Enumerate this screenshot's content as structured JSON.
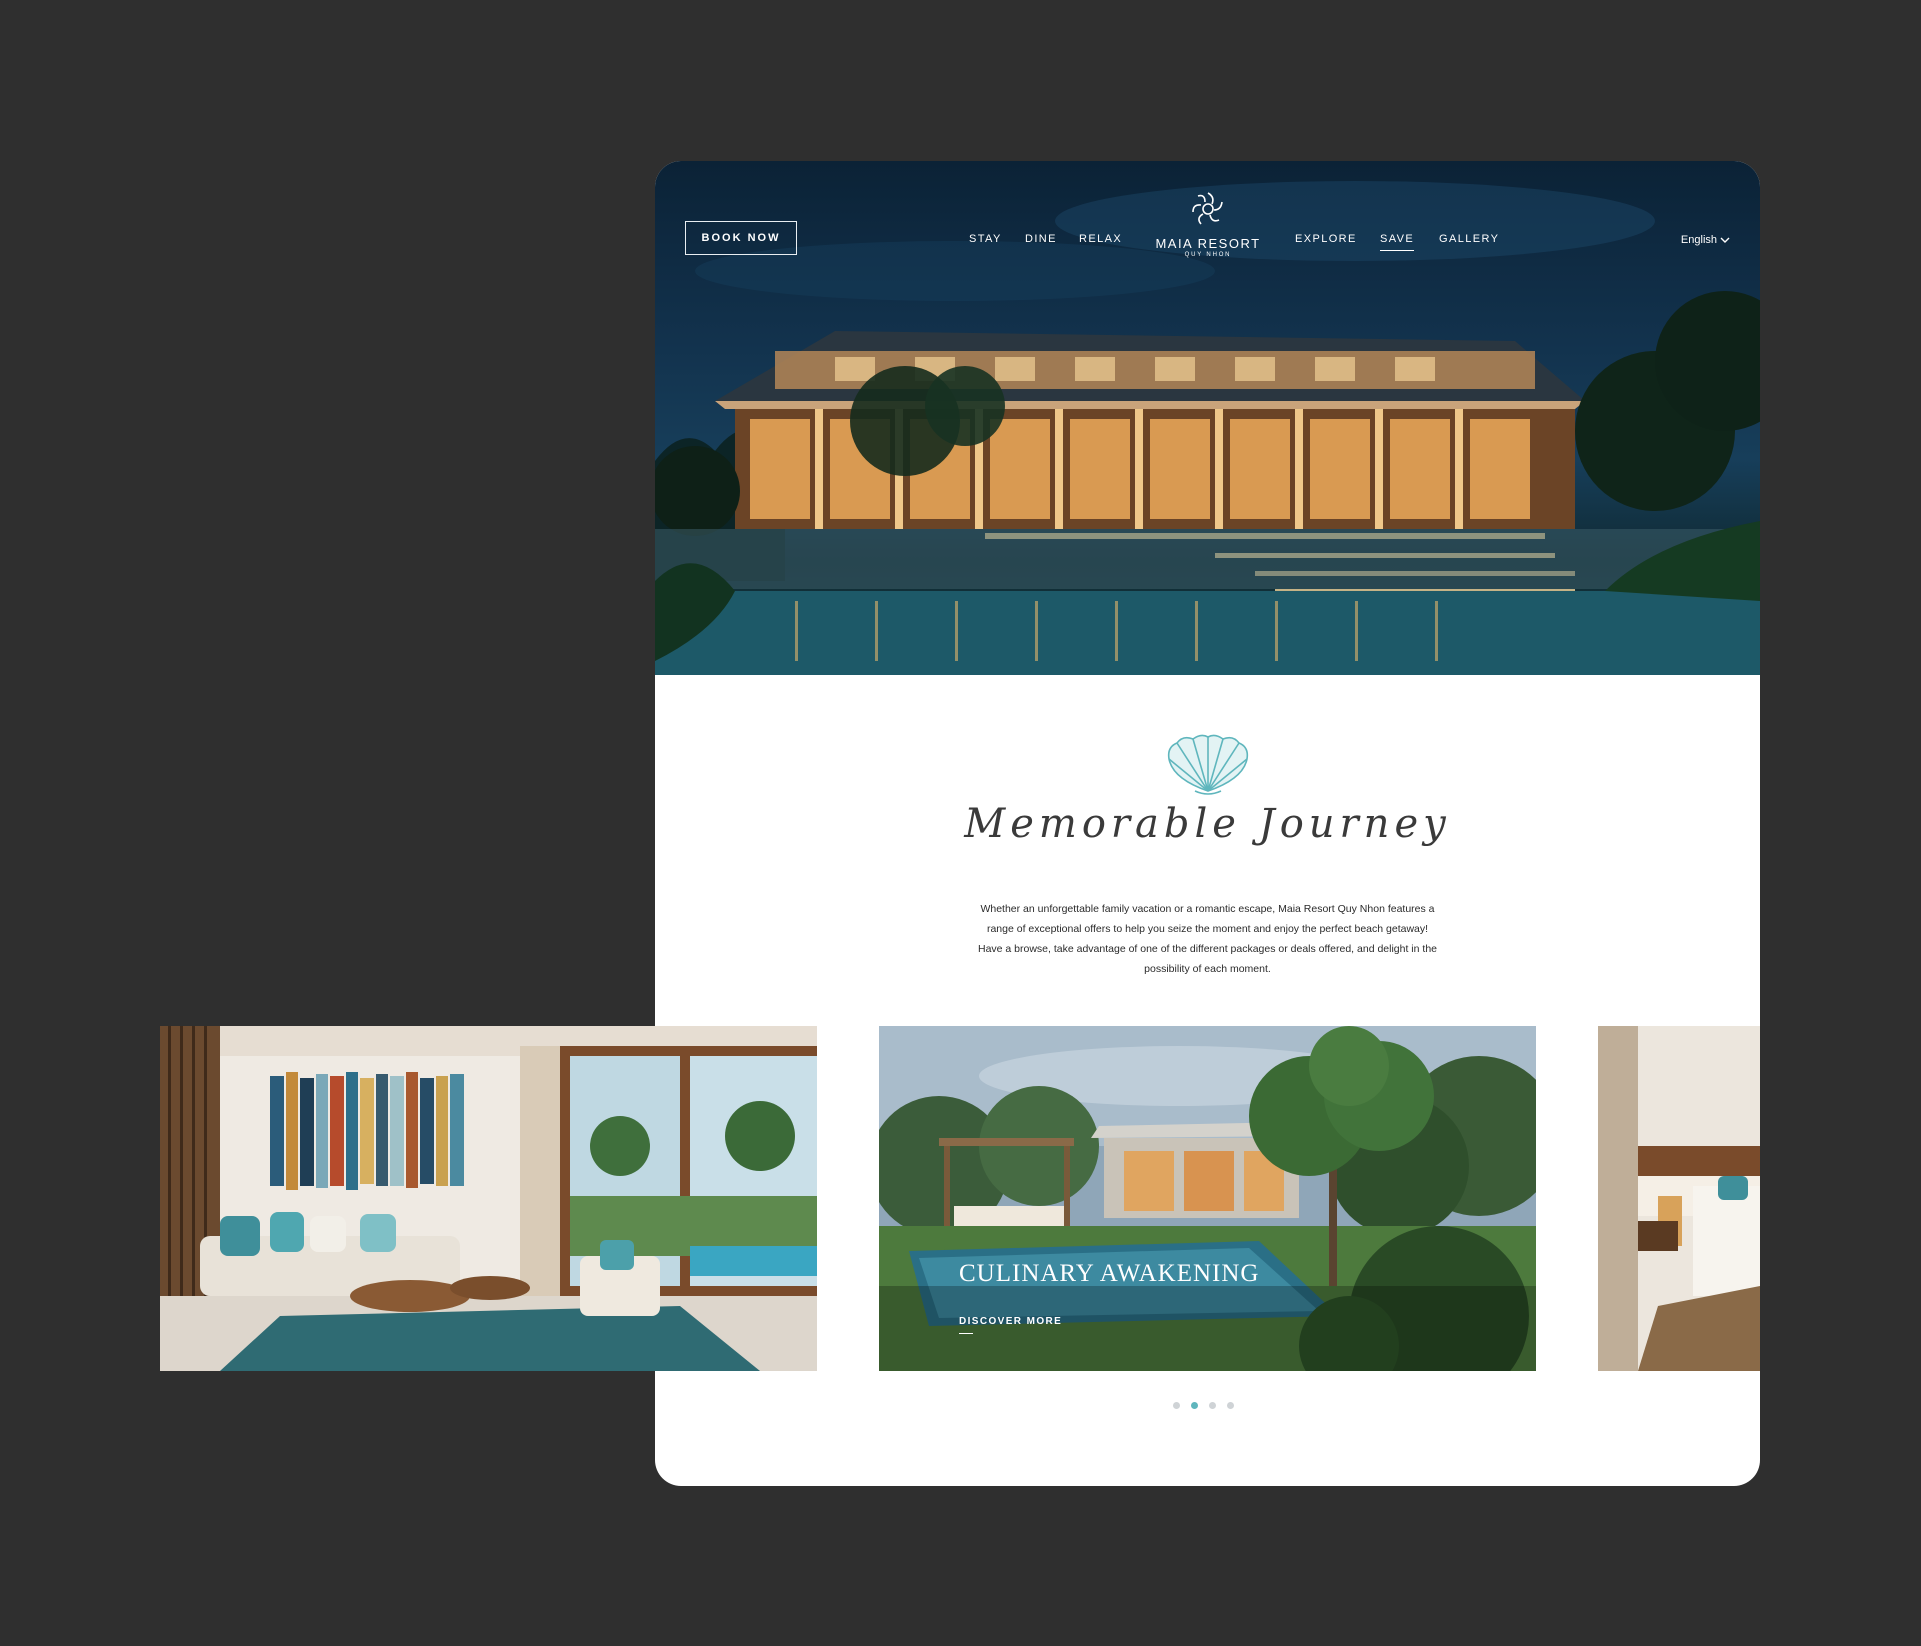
{
  "header": {
    "book_button": "BOOK NOW",
    "nav_left": [
      "STAY",
      "DINE",
      "RELAX"
    ],
    "nav_right": [
      "EXPLORE",
      "SAVE",
      "GALLERY"
    ],
    "active_nav": "SAVE",
    "logo_name": "MAIA RESORT",
    "logo_sub": "QUY NHON",
    "language": "English"
  },
  "intro": {
    "title": "Memorable Journey",
    "body": "Whether an unforgettable family vacation or a romantic escape, Maia Resort Quy Nhon features a range of exceptional offers to help you seize the moment and enjoy the perfect beach getaway! Have a browse, take advantage of one of the different packages or deals offered, and delight in the possibility of each moment."
  },
  "carousel": {
    "slides": [
      {
        "id": "living-room"
      },
      {
        "id": "villa-pool",
        "caption": "CULINARY AWAKENING",
        "cta": "DISCOVER MORE"
      },
      {
        "id": "bedroom"
      }
    ],
    "dot_count": 4,
    "active_dot": 1
  },
  "colors": {
    "background": "#2f2f2f",
    "accent_teal": "#5fb6bd",
    "card": "#ffffff"
  },
  "icons": [
    "maia-flower-logo-icon",
    "seashell-icon",
    "chevron-down-icon"
  ]
}
